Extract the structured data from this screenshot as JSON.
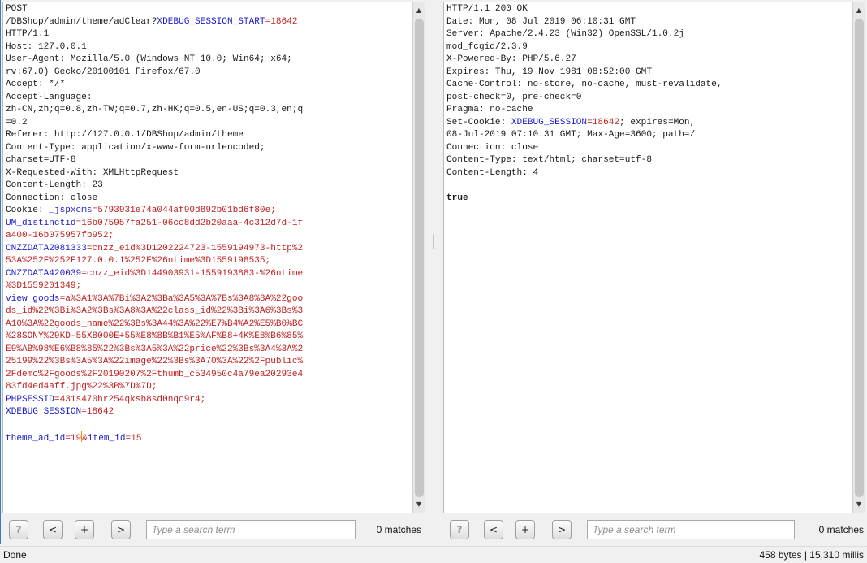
{
  "request": {
    "lines": [
      [
        {
          "t": "POST"
        }
      ],
      [
        {
          "t": "/DBShop/admin/theme/adClear?"
        },
        {
          "t": "XDEBUG_SESSION_START",
          "c": "kname"
        },
        {
          "t": "=18642",
          "c": "kval"
        }
      ],
      [
        {
          "t": "HTTP/1.1"
        }
      ],
      [
        {
          "t": "Host: 127.0.0.1"
        }
      ],
      [
        {
          "t": "User-Agent: Mozilla/5.0 (Windows NT 10.0; Win64; x64;"
        }
      ],
      [
        {
          "t": "rv:67.0) Gecko/20100101 Firefox/67.0"
        }
      ],
      [
        {
          "t": "Accept: */*"
        }
      ],
      [
        {
          "t": "Accept-Language:"
        }
      ],
      [
        {
          "t": "zh-CN,zh;q=0.8,zh-TW;q=0.7,zh-HK;q=0.5,en-US;q=0.3,en;q"
        }
      ],
      [
        {
          "t": "=0.2"
        }
      ],
      [
        {
          "t": "Referer: http://127.0.0.1/DBShop/admin/theme"
        }
      ],
      [
        {
          "t": "Content-Type: application/x-www-form-urlencoded;"
        }
      ],
      [
        {
          "t": "charset=UTF-8"
        }
      ],
      [
        {
          "t": "X-Requested-With: XMLHttpRequest"
        }
      ],
      [
        {
          "t": "Content-Length: 23"
        }
      ],
      [
        {
          "t": "Connection: close"
        }
      ],
      [
        {
          "t": "Cookie: "
        },
        {
          "t": "_jspxcms",
          "c": "kname"
        },
        {
          "t": "=5793931e74a044af90d892b01bd6f80e;",
          "c": "kval"
        }
      ],
      [
        {
          "t": "UM_distinctid",
          "c": "kname"
        },
        {
          "t": "=16b075957fa251-06cc8dd2b20aaa-4c312d7d-1f",
          "c": "kval"
        }
      ],
      [
        {
          "t": "a400-16b075957fb952;",
          "c": "kval"
        }
      ],
      [
        {
          "t": "CNZZDATA2081333",
          "c": "kname"
        },
        {
          "t": "=cnzz_eid%3D1202224723-1559194973-http%2",
          "c": "kval"
        }
      ],
      [
        {
          "t": "53A%252F%252F127.0.0.1%252F%26ntime%3D1559198535;",
          "c": "kval"
        }
      ],
      [
        {
          "t": "CNZZDATA420039",
          "c": "kname"
        },
        {
          "t": "=cnzz_eid%3D144903931-1559193883-%26ntime",
          "c": "kval"
        }
      ],
      [
        {
          "t": "%3D1559201349;",
          "c": "kval"
        }
      ],
      [
        {
          "t": "view_goods",
          "c": "kname"
        },
        {
          "t": "=a%3A1%3A%7Bi%3A2%3Ba%3A5%3A%7Bs%3A8%3A%22goo",
          "c": "kval"
        }
      ],
      [
        {
          "t": "ds_id%22%3Bi%3A2%3Bs%3A8%3A%22class_id%22%3Bi%3A6%3Bs%3",
          "c": "kval"
        }
      ],
      [
        {
          "t": "A10%3A%22goods_name%22%3Bs%3A44%3A%22%E7%B4%A2%E5%B0%BC",
          "c": "kval"
        }
      ],
      [
        {
          "t": "%28SONY%29KD-55X8000E+55%E8%8B%B1%E5%AF%B8+4K%E8%B6%85%",
          "c": "kval"
        }
      ],
      [
        {
          "t": "E9%AB%98%E6%B8%85%22%3Bs%3A5%3A%22price%22%3Bs%3A4%3A%2",
          "c": "kval"
        }
      ],
      [
        {
          "t": "25199%22%3Bs%3A5%3A%22image%22%3Bs%3A70%3A%22%2Fpublic%",
          "c": "kval"
        }
      ],
      [
        {
          "t": "2Fdemo%2Fgoods%2F20190207%2Fthumb_c534950c4a79ea20293e4",
          "c": "kval"
        }
      ],
      [
        {
          "t": "83fd4ed4aff.jpg%22%3B%7D%7D;",
          "c": "kval"
        }
      ],
      [
        {
          "t": "PHPSESSID",
          "c": "kname"
        },
        {
          "t": "=431s470hr254qksb8sd0nqc9r4;",
          "c": "kval"
        }
      ],
      [
        {
          "t": "XDEBUG_SESSION",
          "c": "kname"
        },
        {
          "t": "=18642",
          "c": "kval"
        }
      ],
      [
        {
          "t": ""
        }
      ],
      [
        {
          "t": "theme_ad_id",
          "c": "kname"
        },
        {
          "t": "=19",
          "c": "kval"
        },
        {
          "t": "",
          "c": "cursor"
        },
        {
          "t": "&",
          "c": "kval"
        },
        {
          "t": "item_id",
          "c": "kname"
        },
        {
          "t": "=15",
          "c": "kval"
        }
      ]
    ],
    "search_placeholder": "Type a search term",
    "matches": "0 matches"
  },
  "response": {
    "lines": [
      [
        {
          "t": "HTTP/1.1 200 OK"
        }
      ],
      [
        {
          "t": "Date: Mon, 08 Jul 2019 06:10:31 GMT"
        }
      ],
      [
        {
          "t": "Server: Apache/2.4.23 (Win32) OpenSSL/1.0.2j"
        }
      ],
      [
        {
          "t": "mod_fcgid/2.3.9"
        }
      ],
      [
        {
          "t": "X-Powered-By: PHP/5.6.27"
        }
      ],
      [
        {
          "t": "Expires: Thu, 19 Nov 1981 08:52:00 GMT"
        }
      ],
      [
        {
          "t": "Cache-Control: no-store, no-cache, must-revalidate,"
        }
      ],
      [
        {
          "t": "post-check=0, pre-check=0"
        }
      ],
      [
        {
          "t": "Pragma: no-cache"
        }
      ],
      [
        {
          "t": "Set-Cookie: "
        },
        {
          "t": "XDEBUG_SESSION",
          "c": "kname"
        },
        {
          "t": "=18642",
          "c": "kval"
        },
        {
          "t": "; expires=Mon,"
        }
      ],
      [
        {
          "t": "08-Jul-2019 07:10:31 GMT; Max-Age=3600; path=/"
        }
      ],
      [
        {
          "t": "Connection: close"
        }
      ],
      [
        {
          "t": "Content-Type: text/html; charset=utf-8"
        }
      ],
      [
        {
          "t": "Content-Length: 4"
        }
      ],
      [
        {
          "t": ""
        }
      ],
      [
        {
          "t": "true",
          "c": "bold"
        }
      ]
    ],
    "search_placeholder": "Type a search term",
    "matches": "0 matches"
  },
  "buttons": {
    "help": "?",
    "prev": "<",
    "add": "+",
    "next": ">"
  },
  "status": {
    "left": "Done",
    "right": "458 bytes | 15,310 millis"
  },
  "icons": {
    "scroll_up": "scroll-up-arrow-icon",
    "scroll_down": "scroll-down-arrow-icon"
  },
  "colors": {
    "header_name": "#1a1acf",
    "header_value": "#c02020",
    "cursor": "#ff8c00"
  }
}
